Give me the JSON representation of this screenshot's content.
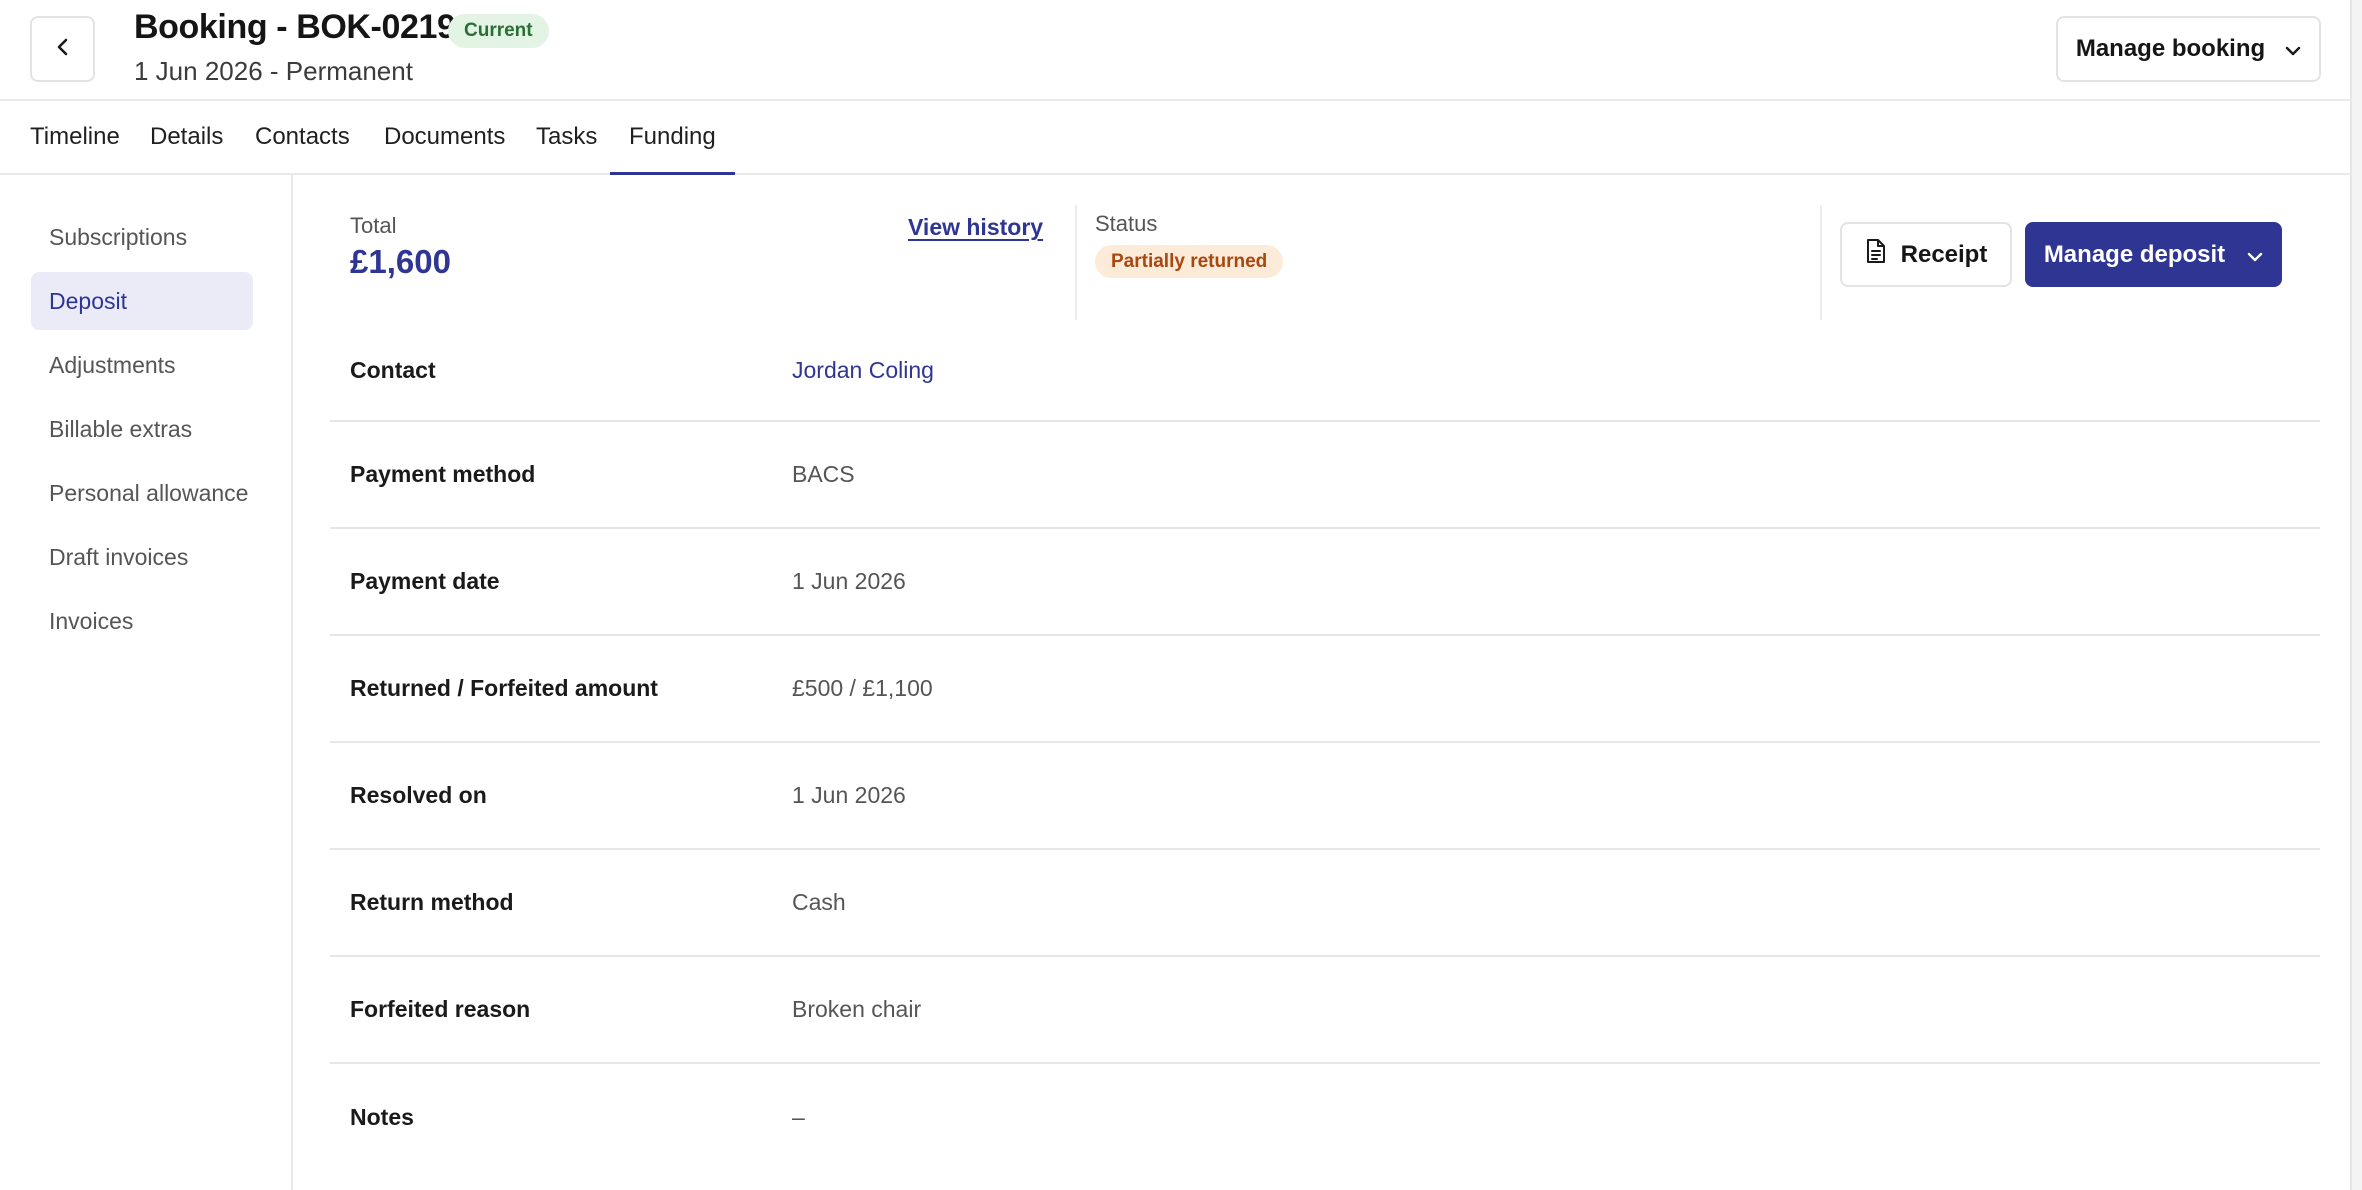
{
  "header": {
    "title": "Booking - BOK-0219",
    "status_badge": "Current",
    "subtitle": "1 Jun 2026 - Permanent",
    "manage_booking_label": "Manage booking"
  },
  "tabs": [
    {
      "label": "Timeline"
    },
    {
      "label": "Details"
    },
    {
      "label": "Contacts"
    },
    {
      "label": "Documents"
    },
    {
      "label": "Tasks"
    },
    {
      "label": "Funding",
      "active": true
    }
  ],
  "sidebar": {
    "items": [
      {
        "label": "Subscriptions"
      },
      {
        "label": "Deposit",
        "active": true
      },
      {
        "label": "Adjustments"
      },
      {
        "label": "Billable extras"
      },
      {
        "label": "Personal allowance"
      },
      {
        "label": "Draft invoices"
      },
      {
        "label": "Invoices"
      }
    ]
  },
  "summary": {
    "total_label": "Total",
    "total_value": "£1,600",
    "view_history_label": "View history",
    "status_label": "Status",
    "status_value": "Partially returned",
    "receipt_label": "Receipt",
    "manage_deposit_label": "Manage deposit"
  },
  "details": [
    {
      "label": "Contact",
      "value": "Jordan Coling"
    },
    {
      "label": "Payment method",
      "value": "BACS"
    },
    {
      "label": "Payment date",
      "value": "1 Jun 2026"
    },
    {
      "label": "Returned / Forfeited amount",
      "value": "£500 / £1,100"
    },
    {
      "label": "Resolved on",
      "value": "1 Jun 2026"
    },
    {
      "label": "Return method",
      "value": "Cash"
    },
    {
      "label": "Forfeited reason",
      "value": "Broken chair"
    },
    {
      "label": "Notes",
      "value": "–"
    }
  ],
  "colors": {
    "accent": "#2f3592",
    "current_badge_bg": "#e3f4e5",
    "current_badge_text": "#2b6e36",
    "status_badge_bg": "#fdebd9",
    "status_badge_text": "#a9470f"
  }
}
